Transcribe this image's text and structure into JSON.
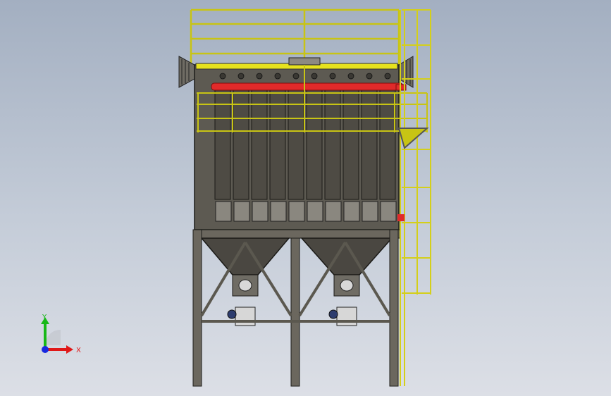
{
  "viewport": {
    "background_top": "#a3afc1",
    "background_bottom": "#dcdfe6"
  },
  "model": {
    "body_color": "#5d5a52",
    "column_color": "#6b675e",
    "railing_color": "#c8c414",
    "header_pipe_color": "#e02a2a",
    "stair_color": "#d4cf1a"
  },
  "triad": {
    "x_label": "X",
    "y_label": "Y",
    "x_color": "#e01818",
    "y_color": "#18b818",
    "z_color": "#1828e0"
  }
}
